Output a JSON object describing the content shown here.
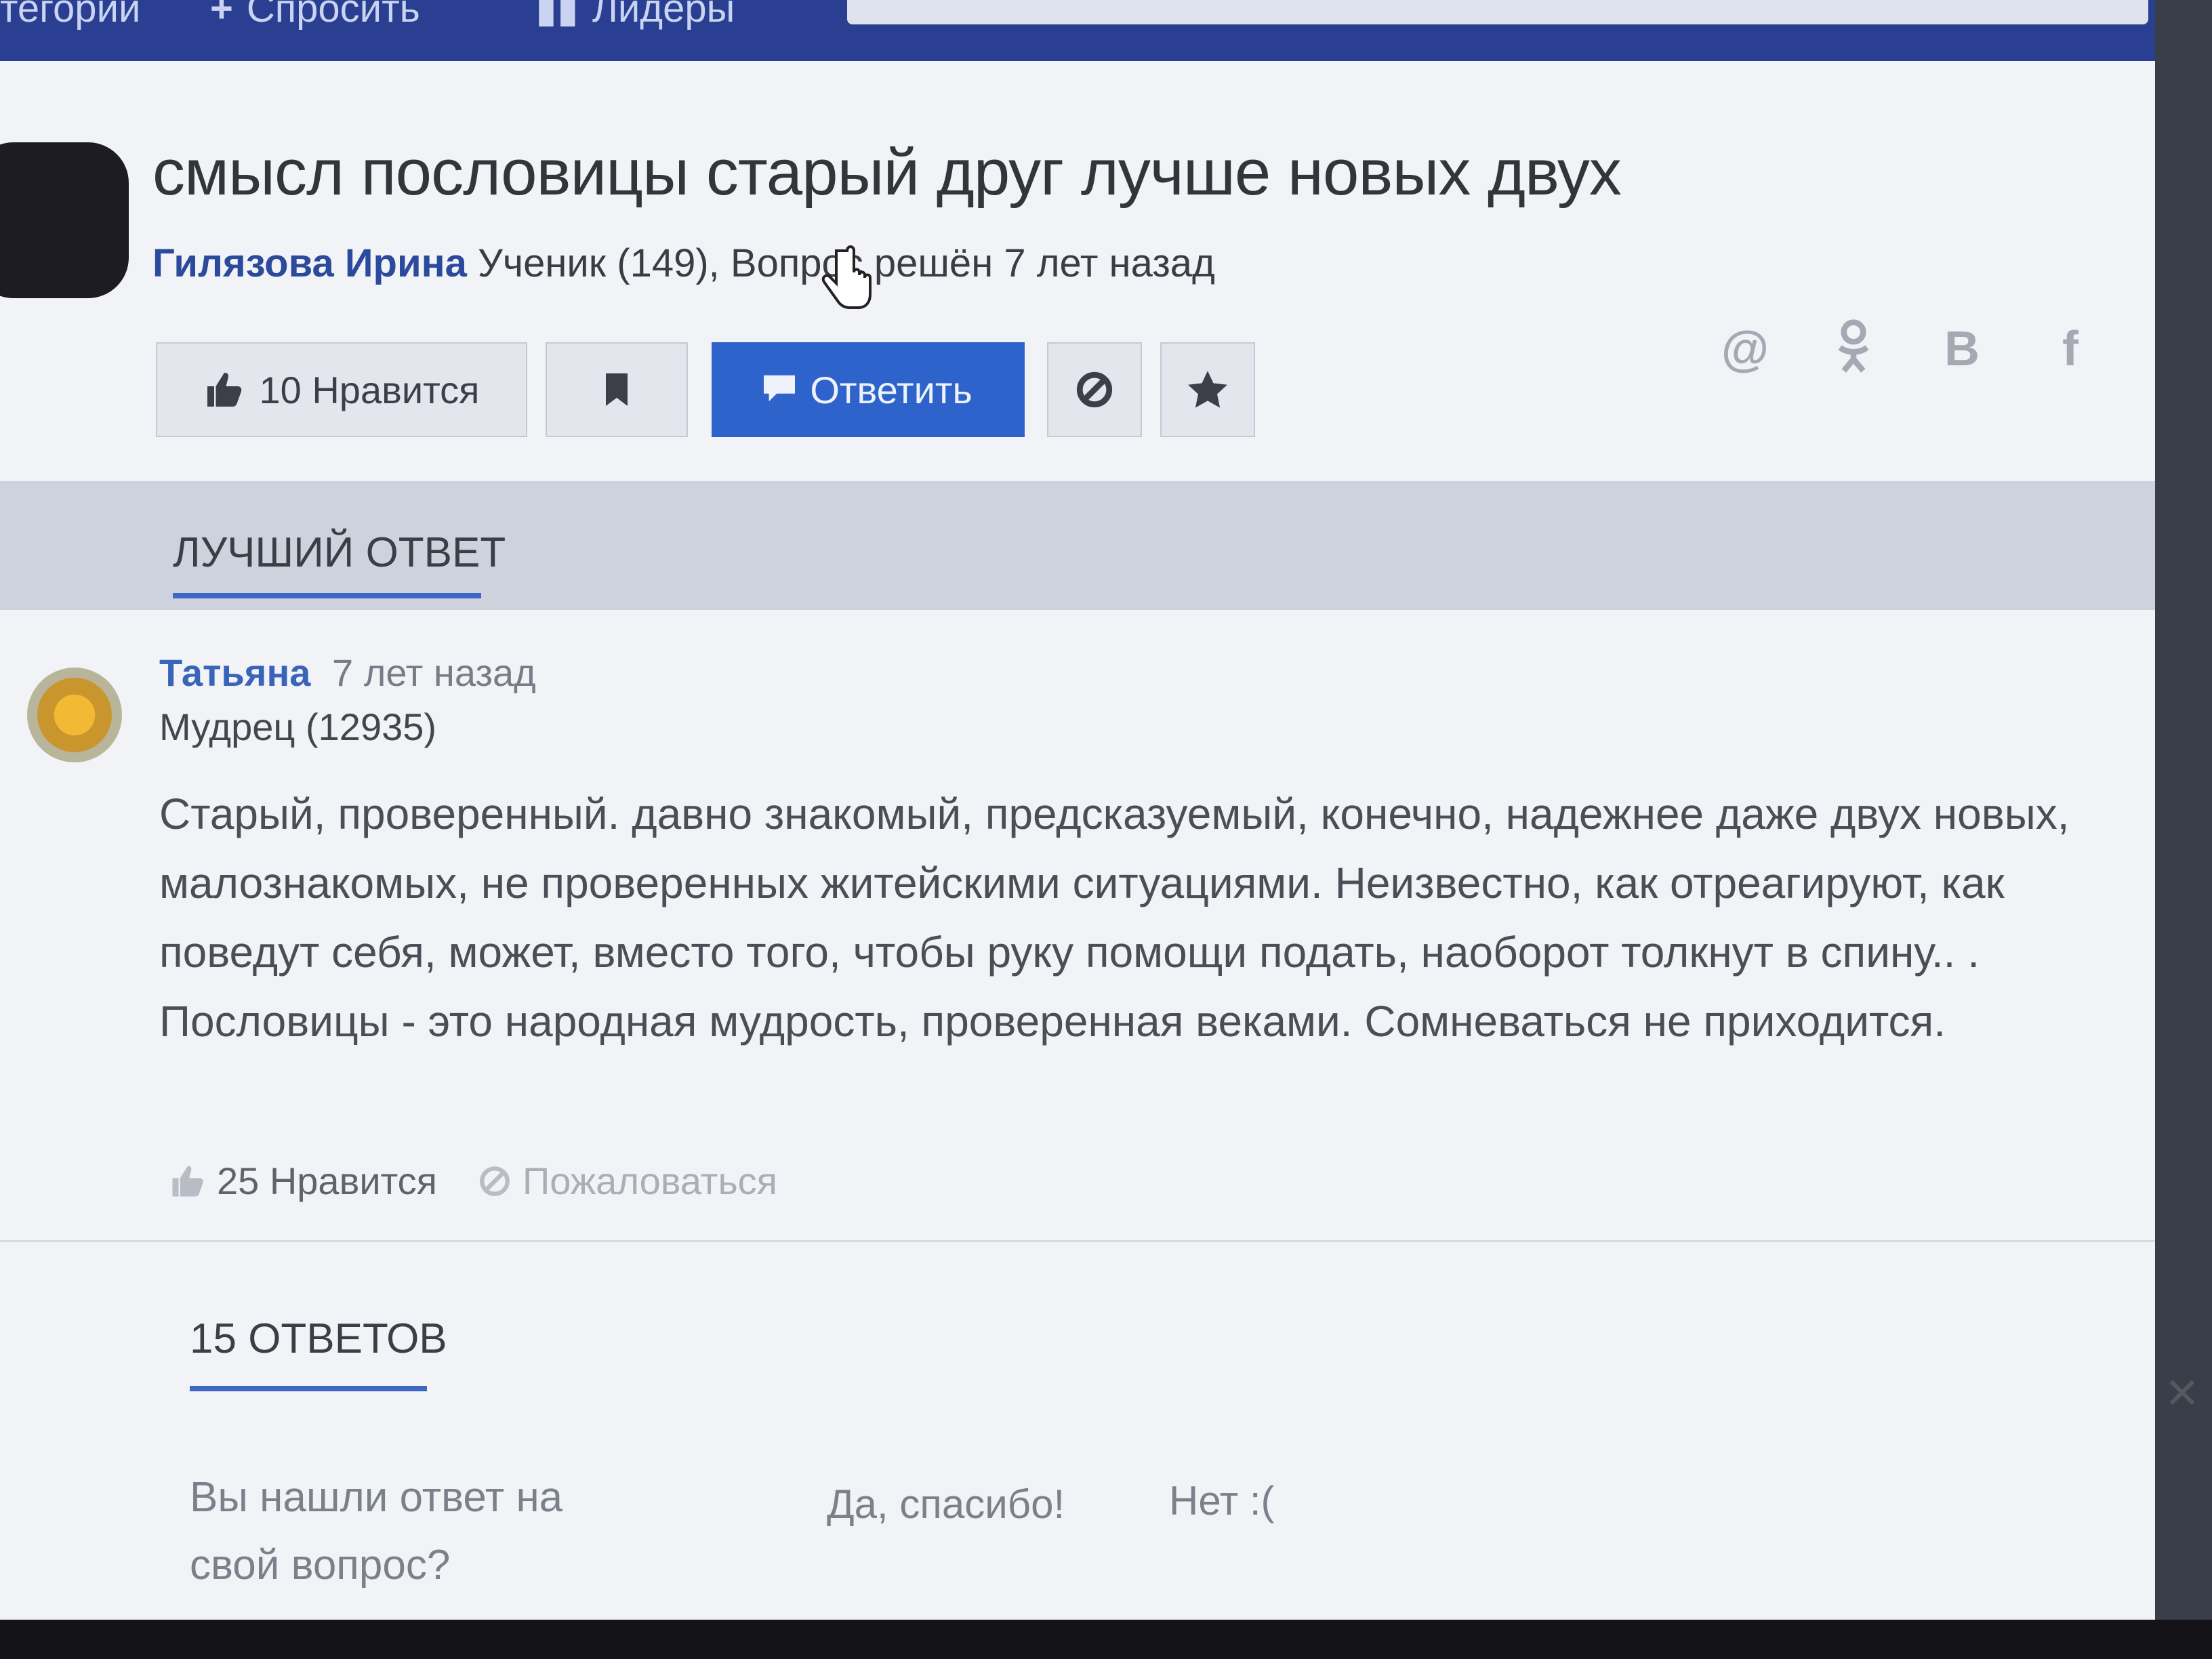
{
  "nav": {
    "categories": "тегории",
    "ask": "Спросить",
    "leaders": "Лидеры"
  },
  "question": {
    "title": "смысл пословицы старый друг лучше новых двух",
    "author": "Гилязова Ирина",
    "meta": "Ученик (149), Вопрос решён 7 лет назад"
  },
  "actions": {
    "like": "10 Нравится",
    "reply": "Ответить"
  },
  "share_icons": [
    "at-icon",
    "odnoklassniki-icon",
    "vk-icon",
    "facebook-icon"
  ],
  "share_labels": {
    "mail": "@",
    "vk": "B",
    "fb": "f"
  },
  "best": {
    "section_title": "ЛУЧШИЙ ОТВЕТ",
    "author": "Татьяна",
    "time": "7 лет назад",
    "rank": "Мудрец (12935)",
    "text": "Старый, проверенный. давно знакомый, предсказуемый, конечно, надежнее даже двух новых, малознакомых, не проверенных житейскими ситуациями. Неизвестно, как отреагируют, как поведут себя, может, вместо того, чтобы руку помощи подать, наоборот толкнут в спину.. . Пословицы - это народная мудрость, проверенная веками. Сомневаться не приходится.",
    "likes": "25 Нравится",
    "report": "Пожаловаться"
  },
  "answers": {
    "title": "15 ОТВЕТОВ"
  },
  "feedback": {
    "question": "Вы нашли ответ на свой вопрос?",
    "yes": "Да, спасибо!",
    "no": "Нет :("
  },
  "colors": {
    "accent": "#2f63cc",
    "topbar": "#2a3f91",
    "link": "#2b4a9c"
  }
}
